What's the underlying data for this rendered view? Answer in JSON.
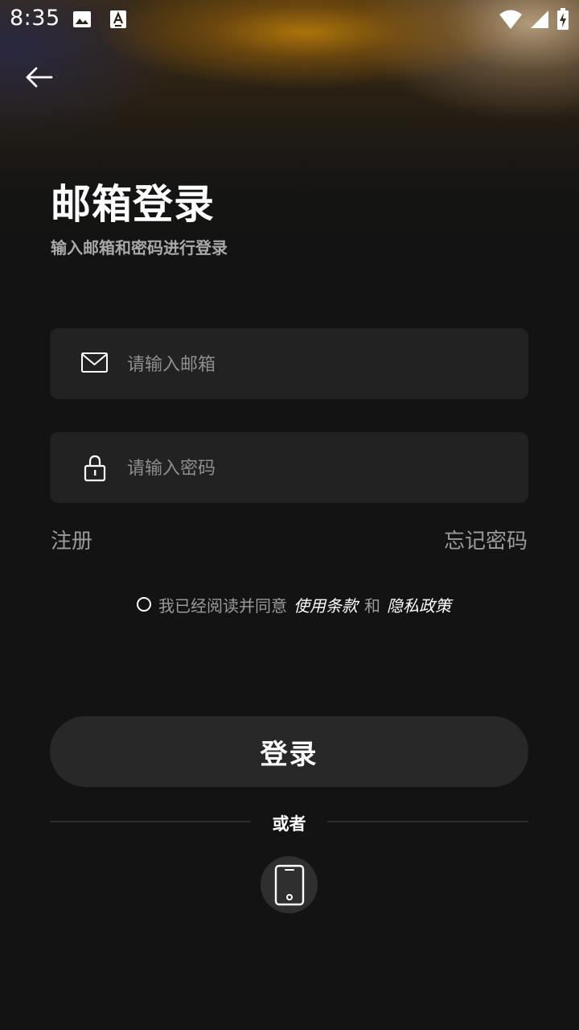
{
  "status_bar": {
    "time": "8:35",
    "icons": [
      "image-icon",
      "a-box-icon",
      "wifi-icon",
      "signal-icon",
      "battery-charging-icon"
    ]
  },
  "header": {
    "title": "邮箱登录",
    "subtitle": "输入邮箱和密码进行登录"
  },
  "form": {
    "email_placeholder": "请输入邮箱",
    "password_placeholder": "请输入密码",
    "register_label": "注册",
    "forgot_label": "忘记密码",
    "agreement": {
      "prefix": "我已经阅读并同意",
      "terms": "使用条款",
      "conjunction": "和",
      "privacy": "隐私政策"
    },
    "login_label": "登录"
  },
  "alternatives": {
    "or_label": "或者"
  },
  "colors": {
    "background": "#131313",
    "field": "#222222",
    "button": "#282828",
    "muted_text": "#9a9a9a"
  }
}
